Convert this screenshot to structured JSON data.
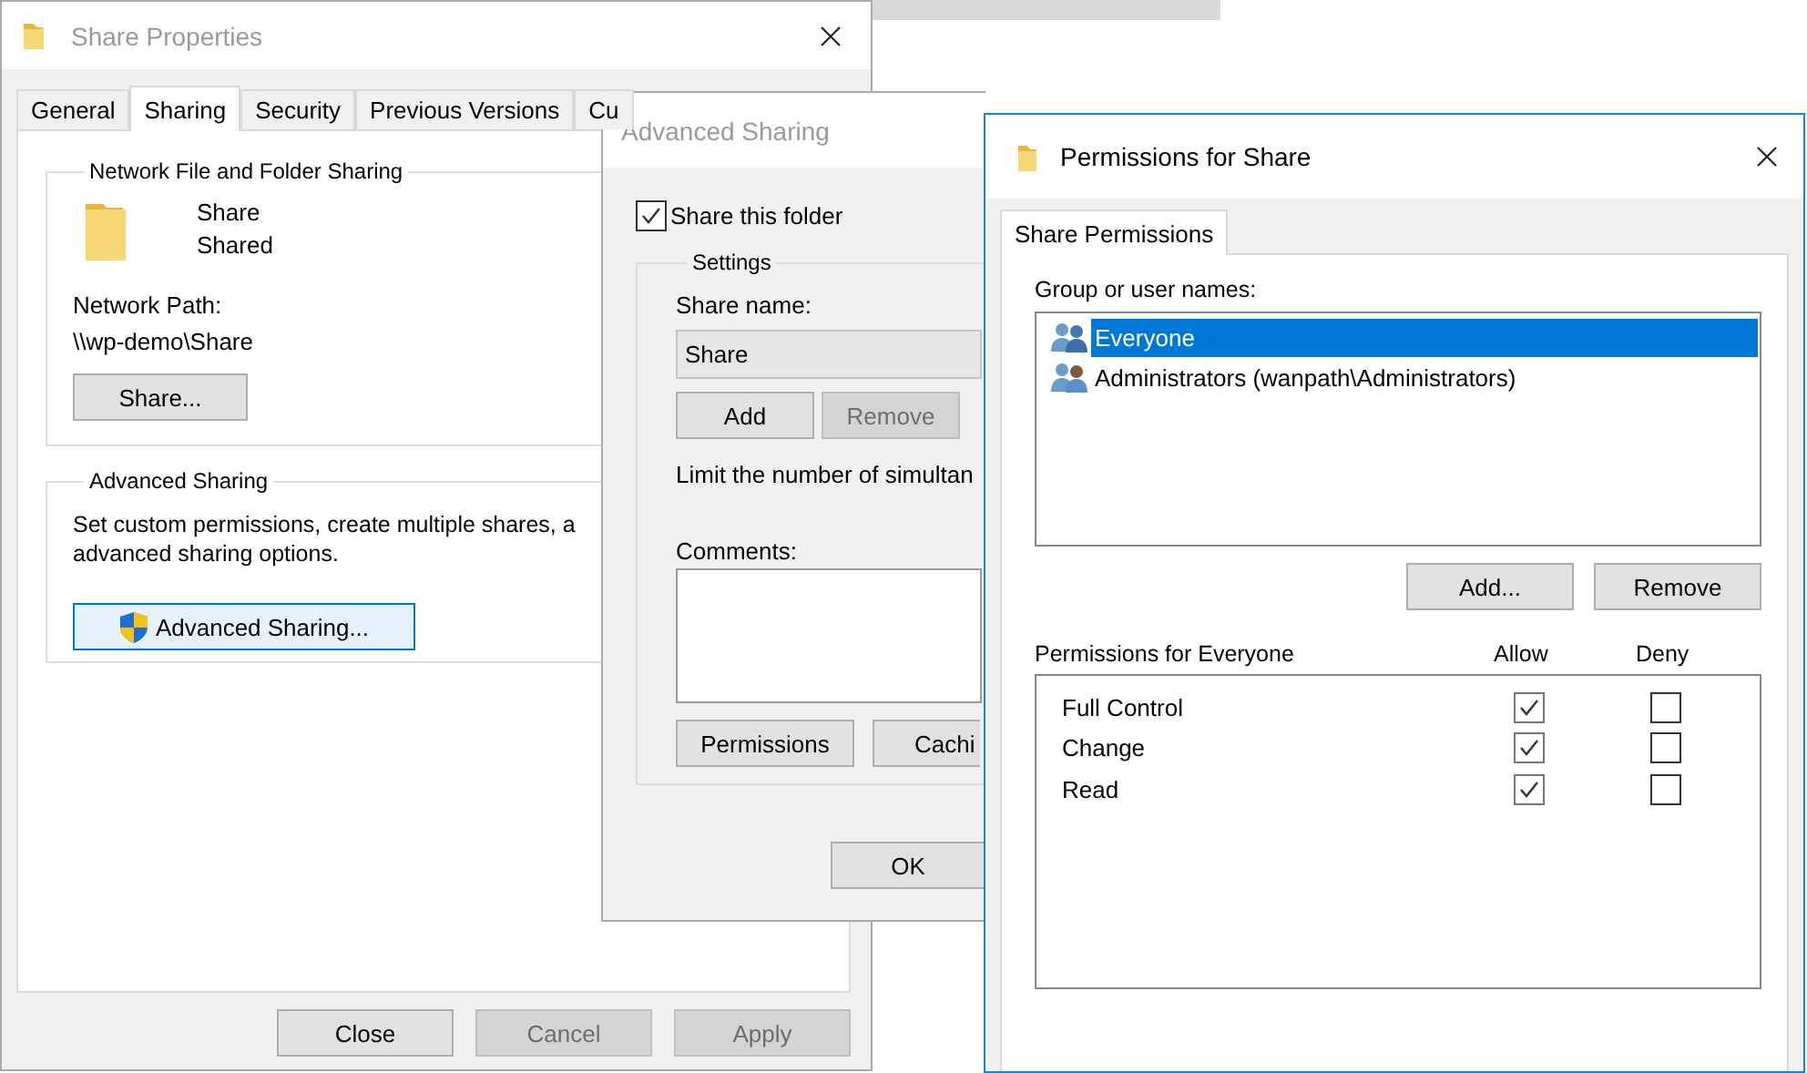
{
  "share_properties": {
    "title": "Share Properties",
    "active": false,
    "tabs": [
      {
        "label": "General",
        "selected": false
      },
      {
        "label": "Sharing",
        "selected": true
      },
      {
        "label": "Security",
        "selected": false
      },
      {
        "label": "Previous Versions",
        "selected": false
      },
      {
        "label": "Cu",
        "selected": false
      }
    ],
    "network_sharing": {
      "heading": "Network File and Folder Sharing",
      "name": "Share",
      "status": "Shared",
      "path_label": "Network Path:",
      "path": "\\\\wp-demo\\Share",
      "button": "Share..."
    },
    "advanced_group": {
      "heading": "Advanced Sharing",
      "description_lines": [
        "Set custom permissions, create multiple shares, a",
        "advanced sharing options."
      ],
      "button": "Advanced Sharing..."
    },
    "buttons": [
      {
        "label": "Close",
        "disabled": false
      },
      {
        "label": "Cancel",
        "disabled": true
      },
      {
        "label": "Apply",
        "disabled": true
      }
    ]
  },
  "advanced_sharing": {
    "title": "Advanced Sharing",
    "active": false,
    "share_this_folder": {
      "label": "Share this folder",
      "checked": true
    },
    "settings": {
      "heading": "Settings",
      "share_name_label": "Share name:",
      "share_name": "Share",
      "name_buttons": [
        {
          "label": "Add",
          "disabled": false
        },
        {
          "label": "Remove",
          "disabled": true
        }
      ],
      "limit_text": "Limit the number of simultan",
      "comments_label": "Comments:",
      "buttons": [
        {
          "label": "Permissions",
          "disabled": false
        },
        {
          "label": "Cachi",
          "disabled": false
        }
      ]
    },
    "ok_button": "OK"
  },
  "permissions": {
    "title": "Permissions for Share",
    "active": true,
    "tabs": [
      {
        "label": "Share Permissions",
        "selected": true
      }
    ],
    "group_label": "Group or user names:",
    "users": [
      {
        "name": "Everyone",
        "selected": true
      },
      {
        "name": "Administrators (wanpath\\Administrators)",
        "selected": false
      }
    ],
    "buttons": [
      {
        "label": "Add...",
        "disabled": false
      },
      {
        "label": "Remove",
        "disabled": false
      }
    ],
    "permissions_heading": "Permissions for Everyone",
    "allow_label": "Allow",
    "deny_label": "Deny",
    "permissions": [
      {
        "name": "Full Control",
        "allow": true,
        "deny": false
      },
      {
        "name": "Change",
        "allow": true,
        "deny": false
      },
      {
        "name": "Read",
        "allow": true,
        "deny": false
      }
    ]
  }
}
